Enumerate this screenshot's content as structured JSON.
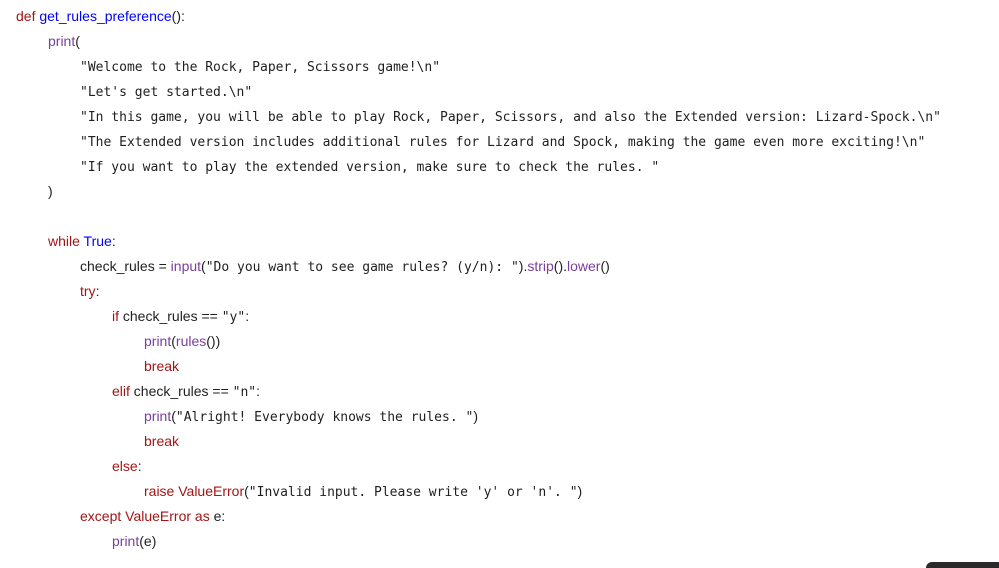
{
  "code": {
    "lines": [
      {
        "indent": 16,
        "tokens": [
          {
            "text": "def ",
            "cls": "kw"
          },
          {
            "text": "get_rules_preference",
            "cls": "def"
          },
          {
            "text": "():",
            "cls": "plain"
          }
        ]
      },
      {
        "indent": 48,
        "tokens": [
          {
            "text": "print",
            "cls": "fn"
          },
          {
            "text": "(",
            "cls": "plain"
          }
        ]
      },
      {
        "indent": 80,
        "tokens": [
          {
            "text": "\"Welcome to the Rock, Paper, Scissors game!\\n\"",
            "cls": "str"
          }
        ]
      },
      {
        "indent": 80,
        "tokens": [
          {
            "text": "\"Let's get started.\\n\"",
            "cls": "str"
          }
        ]
      },
      {
        "indent": 80,
        "tokens": [
          {
            "text": "\"In this game, you will be able to play Rock, Paper, Scissors, and also the Extended version: Lizard-Spock.\\n\"",
            "cls": "str"
          }
        ]
      },
      {
        "indent": 80,
        "tokens": [
          {
            "text": "\"The Extended version includes additional rules for Lizard and Spock, making the game even more exciting!\\n\"",
            "cls": "str"
          }
        ]
      },
      {
        "indent": 80,
        "tokens": [
          {
            "text": "\"If you want to play the extended version, make sure to check the rules. \"",
            "cls": "str"
          }
        ]
      },
      {
        "indent": 48,
        "tokens": [
          {
            "text": ")",
            "cls": "plain"
          }
        ]
      },
      {
        "indent": 0,
        "tokens": []
      },
      {
        "indent": 48,
        "tokens": [
          {
            "text": "while ",
            "cls": "kw"
          },
          {
            "text": "True",
            "cls": "def"
          },
          {
            "text": ":",
            "cls": "plain"
          }
        ]
      },
      {
        "indent": 80,
        "tokens": [
          {
            "text": "check_rules ",
            "cls": "plain"
          },
          {
            "text": "= ",
            "cls": "op"
          },
          {
            "text": "input",
            "cls": "fn"
          },
          {
            "text": "(",
            "cls": "plain"
          },
          {
            "text": "\"Do you want to see game rules? (y/n): \"",
            "cls": "str"
          },
          {
            "text": ").",
            "cls": "plain"
          },
          {
            "text": "strip",
            "cls": "fn"
          },
          {
            "text": "().",
            "cls": "plain"
          },
          {
            "text": "lower",
            "cls": "fn"
          },
          {
            "text": "()",
            "cls": "plain"
          }
        ]
      },
      {
        "indent": 80,
        "tokens": [
          {
            "text": "try",
            "cls": "kw"
          },
          {
            "text": ":",
            "cls": "plain"
          }
        ]
      },
      {
        "indent": 112,
        "tokens": [
          {
            "text": "if ",
            "cls": "kw"
          },
          {
            "text": "check_rules ",
            "cls": "plain"
          },
          {
            "text": "== ",
            "cls": "op"
          },
          {
            "text": "\"y\"",
            "cls": "str"
          },
          {
            "text": ":",
            "cls": "plain"
          }
        ]
      },
      {
        "indent": 144,
        "tokens": [
          {
            "text": "print",
            "cls": "fn"
          },
          {
            "text": "(",
            "cls": "plain"
          },
          {
            "text": "rules",
            "cls": "fn"
          },
          {
            "text": "())",
            "cls": "plain"
          }
        ]
      },
      {
        "indent": 144,
        "tokens": [
          {
            "text": "break",
            "cls": "kw"
          }
        ]
      },
      {
        "indent": 112,
        "tokens": [
          {
            "text": "elif ",
            "cls": "kw"
          },
          {
            "text": "check_rules ",
            "cls": "plain"
          },
          {
            "text": "== ",
            "cls": "op"
          },
          {
            "text": "\"n\"",
            "cls": "str"
          },
          {
            "text": ":",
            "cls": "plain"
          }
        ]
      },
      {
        "indent": 144,
        "tokens": [
          {
            "text": "print",
            "cls": "fn"
          },
          {
            "text": "(",
            "cls": "plain"
          },
          {
            "text": "\"Alright! Everybody knows the rules. \"",
            "cls": "str"
          },
          {
            "text": ")",
            "cls": "plain"
          }
        ]
      },
      {
        "indent": 144,
        "tokens": [
          {
            "text": "break",
            "cls": "kw"
          }
        ]
      },
      {
        "indent": 112,
        "tokens": [
          {
            "text": "else",
            "cls": "kw"
          },
          {
            "text": ":",
            "cls": "plain"
          }
        ]
      },
      {
        "indent": 144,
        "tokens": [
          {
            "text": "raise ",
            "cls": "kw"
          },
          {
            "text": "ValueError",
            "cls": "kw"
          },
          {
            "text": "(",
            "cls": "plain"
          },
          {
            "text": "\"Invalid input. Please write 'y' or 'n'. \"",
            "cls": "str"
          },
          {
            "text": ")",
            "cls": "plain"
          }
        ]
      },
      {
        "indent": 80,
        "tokens": [
          {
            "text": "except ",
            "cls": "kw"
          },
          {
            "text": "ValueError ",
            "cls": "kw"
          },
          {
            "text": "as ",
            "cls": "kw"
          },
          {
            "text": "e",
            "cls": "plain"
          },
          {
            "text": ":",
            "cls": "plain"
          }
        ]
      },
      {
        "indent": 112,
        "tokens": [
          {
            "text": "print",
            "cls": "fn"
          },
          {
            "text": "(",
            "cls": "plain"
          },
          {
            "text": "e",
            "cls": "plain"
          },
          {
            "text": ")",
            "cls": "plain"
          }
        ]
      }
    ]
  },
  "colors": {
    "background": "#ffffff",
    "keyword": "#a31515",
    "function": "#7a3e9d",
    "definition": "#0000ff",
    "text": "#1f1f1f"
  }
}
